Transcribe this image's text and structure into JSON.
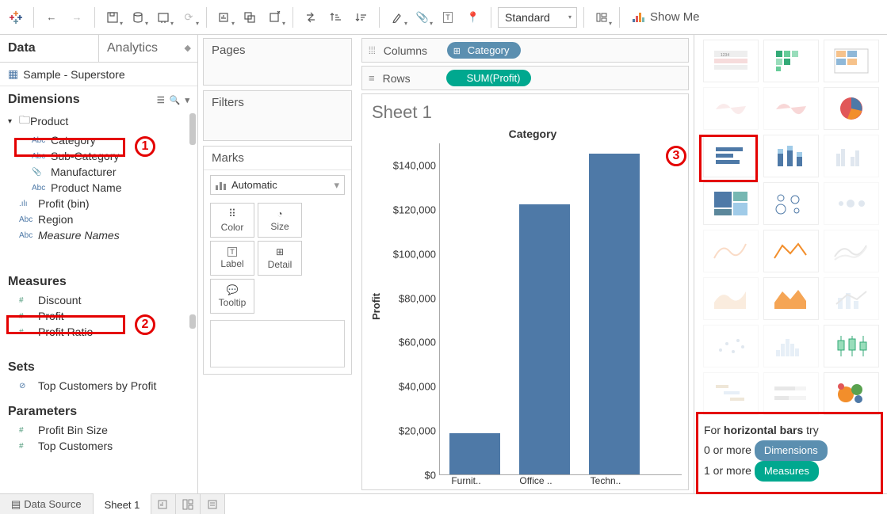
{
  "toolbar": {
    "view_mode": "Standard",
    "showme_label": "Show Me"
  },
  "left": {
    "tab_data": "Data",
    "tab_analytics": "Analytics",
    "datasource": "Sample - Superstore",
    "hdr_dimensions": "Dimensions",
    "hdr_measures": "Measures",
    "hdr_sets": "Sets",
    "hdr_parameters": "Parameters",
    "dims": {
      "product": "Product",
      "category": "Category",
      "subcategory": "Sub-Category",
      "manufacturer": "Manufacturer",
      "productname": "Product Name",
      "profitbin": "Profit (bin)",
      "region": "Region",
      "measurenames": "Measure Names"
    },
    "measures": {
      "discount": "Discount",
      "profit": "Profit",
      "profitratio": "Profit Ratio"
    },
    "sets": {
      "topcust": "Top Customers by Profit"
    },
    "params": {
      "profitbinsize": "Profit Bin Size",
      "topcustomers": "Top Customers"
    }
  },
  "mid": {
    "pages": "Pages",
    "filters": "Filters",
    "marks": "Marks",
    "marks_type": "Automatic",
    "btn_color": "Color",
    "btn_size": "Size",
    "btn_label": "Label",
    "btn_detail": "Detail",
    "btn_tooltip": "Tooltip"
  },
  "shelves": {
    "columns_label": "Columns",
    "rows_label": "Rows",
    "col_pill": "Category",
    "row_pill": "SUM(Profit)"
  },
  "viz": {
    "sheet_title": "Sheet 1",
    "chart_title": "Category",
    "y_axis_label": "Profit"
  },
  "chart_data": {
    "type": "bar",
    "categories": [
      "Furniture",
      "Office Supplies",
      "Technology"
    ],
    "categories_trunc": [
      "Furnit..",
      "Office ..",
      "Techn.."
    ],
    "values": [
      18500,
      122500,
      145500
    ],
    "ylim": [
      0,
      150000
    ],
    "y_ticks": [
      "$0",
      "$20,000",
      "$40,000",
      "$60,000",
      "$80,000",
      "$100,000",
      "$120,000",
      "$140,000"
    ],
    "title": "Category",
    "ylabel": "Profit"
  },
  "showme": {
    "hint_prefix": "For ",
    "hint_bold": "horizontal bars",
    "hint_suffix": " try",
    "line1_prefix": "0 or more ",
    "line1_pill": "Dimensions",
    "line2_prefix": "1 or more ",
    "line2_pill": "Measures"
  },
  "footer": {
    "datasource": "Data Source",
    "sheet": "Sheet 1"
  },
  "icons": {
    "abc": "Abc",
    "num": "#",
    "bin": ".ılı",
    "clip": "📎",
    "set": "⊘",
    "db": "▤"
  }
}
